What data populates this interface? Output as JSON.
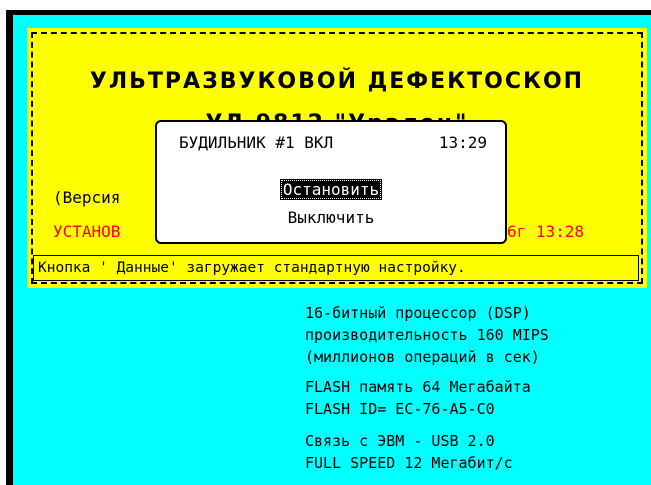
{
  "banner": {
    "title_line1": "УЛЬТРАЗВУКОВОЙ ДЕФЕКТОСКОП",
    "title_line2": "УД 9812 \"Уралец\"",
    "version_text": "(Версия",
    "setup_left": "УСТАНОВ",
    "setup_right": "6г 13:28",
    "note": "Кнопка ' Данные'  загружает стандартную настройку."
  },
  "specs": {
    "cpu": [
      "16-битный процессор (DSP)",
      "производительность 160 MIPS",
      "(миллионов операций в сек)"
    ],
    "flash": [
      "FLASH память 64 Мегабайта",
      "FLASH ID= EC-76-A5-C0"
    ],
    "usb": [
      "Связь с ЭВМ - USB 2.0",
      "FULL SPEED 12 Мегабит/с"
    ]
  },
  "alarm_dialog": {
    "title": "БУДИЛЬНИК #1 ВКЛ",
    "time": "13:29",
    "stop_label": "Остановить",
    "off_label": "Выключить"
  },
  "colors": {
    "background": "#00ffff",
    "banner": "#ffff00",
    "highlight": "#ff0000"
  }
}
